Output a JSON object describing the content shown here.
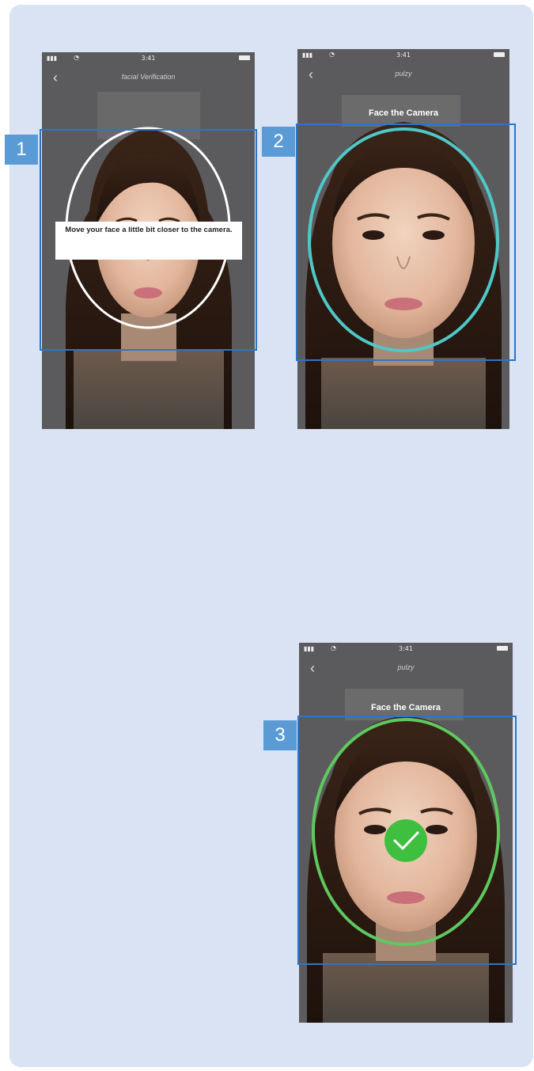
{
  "steps": [
    {
      "number": "1",
      "title": "facial Verification",
      "message": "Move your face a little bit closer to the camera.",
      "oval_color": "#ffffff"
    },
    {
      "number": "2",
      "title": "pulzy",
      "camera_title": "Face the Camera",
      "oval_color": "#4fc8c8"
    },
    {
      "number": "3",
      "title": "pulzy",
      "camera_title": "Face the Camera",
      "oval_color": "#5fc85f",
      "success_icon": "check-icon",
      "success_color": "#3fbf3f"
    }
  ],
  "statusbar": {
    "time": "3:41"
  },
  "frame_color": "#2e74c9",
  "badge_color": "#5b9bd5",
  "background_color": "#dae3f3"
}
